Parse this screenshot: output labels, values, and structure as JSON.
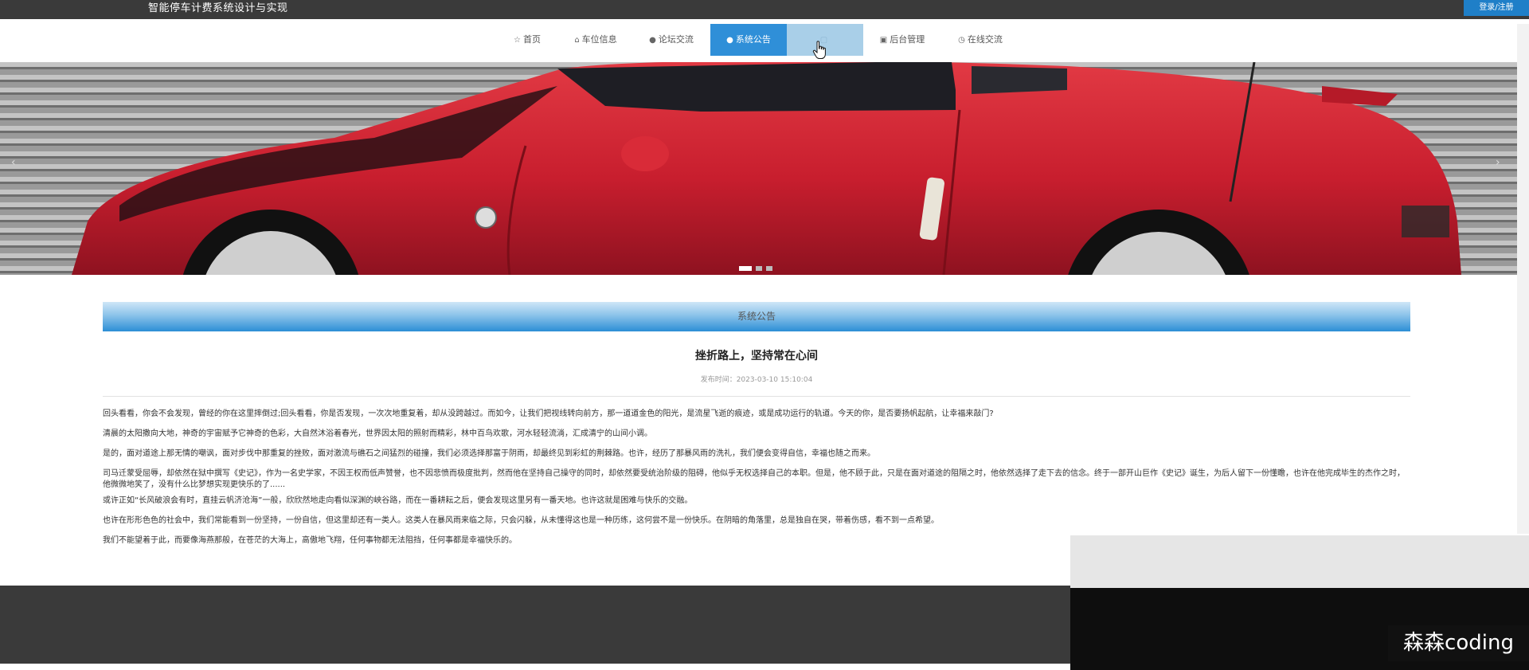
{
  "header": {
    "site_title": "智能停车计费系统设计与实现",
    "login_label": "登录/注册"
  },
  "nav": {
    "items": [
      {
        "label": "首页",
        "icon": "star-icon"
      },
      {
        "label": "车位信息",
        "icon": "home-icon"
      },
      {
        "label": "论坛交流",
        "icon": "info-icon"
      },
      {
        "label": "系统公告",
        "icon": "circle-icon",
        "state": "active"
      },
      {
        "label": "",
        "icon": "blank-icon",
        "state": "hover"
      },
      {
        "label": "后台管理",
        "icon": "calendar-icon"
      },
      {
        "label": "在线交流",
        "icon": "clock-icon"
      }
    ]
  },
  "carousel": {
    "prev_label": "‹",
    "next_label": "›",
    "slide_count": 3,
    "active_index": 0
  },
  "section": {
    "title": "系统公告"
  },
  "article": {
    "title": "挫折路上，坚持常在心间",
    "publish_time": "发布时间：2023-03-10 15:10:04",
    "paragraphs": [
      "回头看看，你会不会发现，曾经的你在这里摔倒过;回头看看，你是否发现，一次次地重复着，却从没跨越过。而如今，让我们把视线转向前方，那一道道金色的阳光，是流星飞逝的痕迹，或是成功运行的轨道。今天的你，是否要扬帆起航，让幸福来敲门?",
      "清晨的太阳撒向大地，神奇的宇宙赋予它神奇的色彩，大自然沐浴着春光，世界因太阳的照射而精彩，林中百鸟欢歌，河水轻轻流淌，汇成清宁的山间小调。",
      "是的，面对道途上那无情的嘲讽，面对步伐中那重复的挫败，面对激流与礁石之间猛烈的碰撞，我们必须选择那富于阴雨，却最终见到彩虹的荆棘路。也许，经历了那暴风雨的洗礼，我们便会变得自信，幸福也随之而来。",
      "司马迁蒙受屈辱，却依然在狱中撰写《史记》，作为一名史学家，不因王权而低声赞誉，也不因悲愤而极度批判，然而他在坚持自己操守的同时，却依然要受统治阶级的阻碍，他似乎无权选择自己的本职。但是，他不顾于此，只是在面对道途的阻隔之时，他依然选择了走下去的信念。终于一部开山巨作《史记》诞生，为后人留下一份懂瞻，也许在他完成毕生的杰作之时，他微微地笑了，没有什么比梦想实现更快乐的了......",
      "或许正如“长风破浪会有时，直挂云帆济沧海”一般，欣欣然地走向看似深渊的峡谷路，而在一番耕耘之后，便会发现这里另有一番天地。也许这就是困难与快乐的交融。",
      "也许在形形色色的社会中，我们常能看到一份坚持，一份自信，但这里却还有一类人。这类人在暴风雨来临之际，只会闪躲，从未懂得这也是一种历练，这何尝不是一份快乐。在阴暗的角落里，总是独自在哭，带着伤感，看不到一点希望。",
      "我们不能望着于此，而要像海燕那般，在苍茫的大海上，高傲地飞翔，任何事物都无法阻挡，任何事都是幸福快乐的。"
    ]
  },
  "watermark": {
    "text": "森森coding"
  },
  "colors": {
    "topbar": "#3a3a3a",
    "accent": "#2f8fd8",
    "login": "#1f7fc8",
    "car_red": "#c81e2e"
  }
}
